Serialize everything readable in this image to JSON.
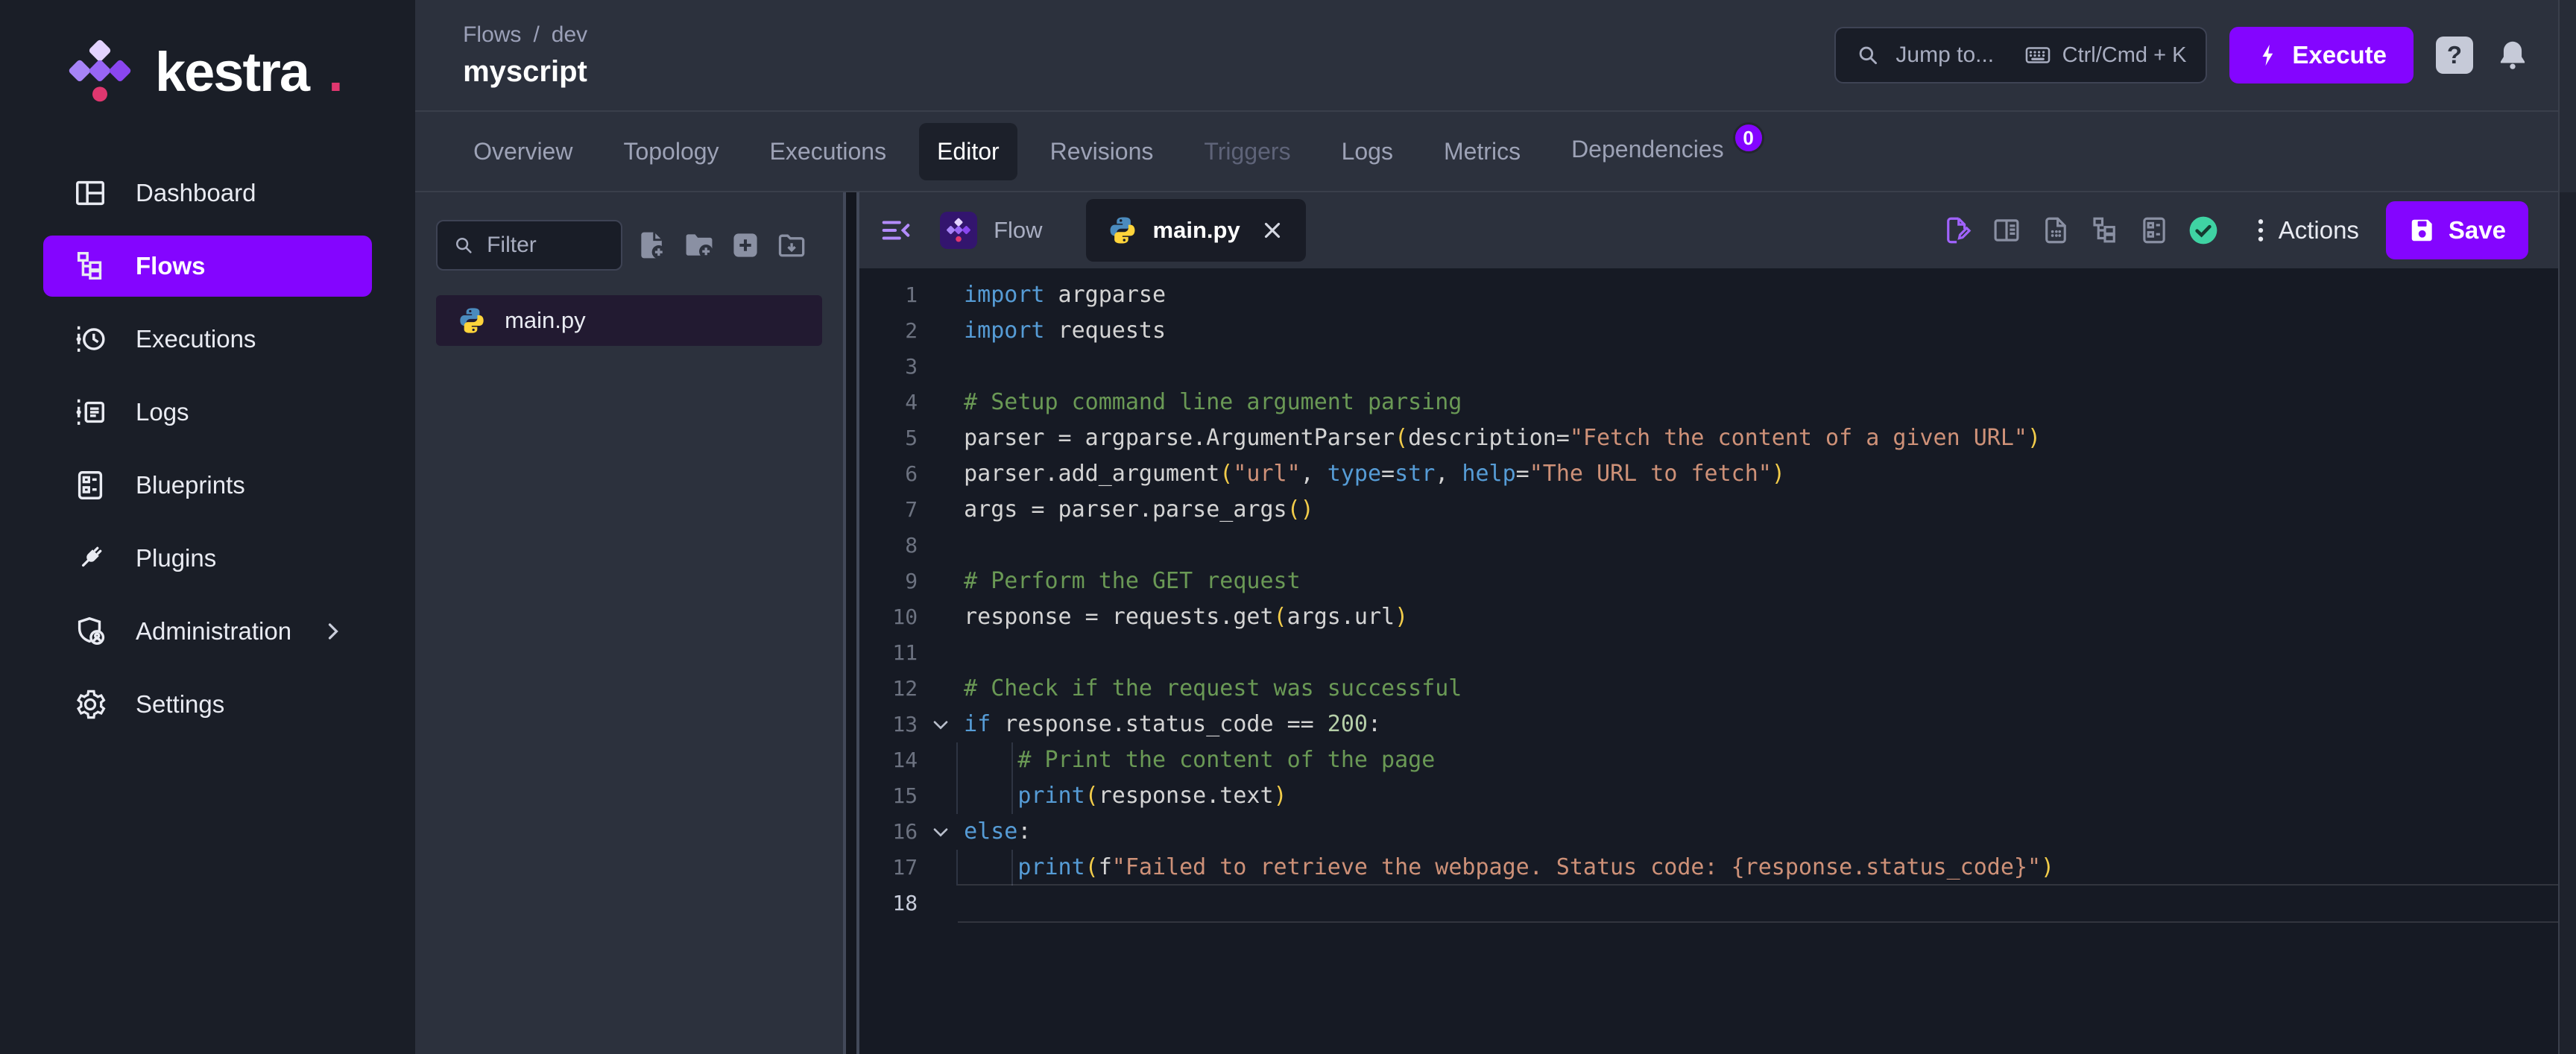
{
  "brand": {
    "name": "kestra",
    "suffix": ".",
    "accent_color": "#8405FF",
    "dot_color": "#E0376F"
  },
  "sidebar": {
    "items": [
      {
        "label": "Dashboard",
        "icon": "dashboard"
      },
      {
        "label": "Flows",
        "icon": "flows",
        "active": true
      },
      {
        "label": "Executions",
        "icon": "executions"
      },
      {
        "label": "Logs",
        "icon": "logs"
      },
      {
        "label": "Blueprints",
        "icon": "blueprints"
      },
      {
        "label": "Plugins",
        "icon": "plugins"
      },
      {
        "label": "Administration",
        "icon": "administration",
        "chevron": true
      },
      {
        "label": "Settings",
        "icon": "settings"
      }
    ]
  },
  "header": {
    "breadcrumb": [
      "Flows",
      "dev"
    ],
    "breadcrumb_separator": "/",
    "title": "myscript",
    "search": {
      "placeholder": "Jump to...",
      "shortcut": "Ctrl/Cmd + K"
    },
    "execute_label": "Execute",
    "help_label": "?"
  },
  "tabs": [
    {
      "label": "Overview"
    },
    {
      "label": "Topology"
    },
    {
      "label": "Executions"
    },
    {
      "label": "Editor",
      "active": true
    },
    {
      "label": "Revisions"
    },
    {
      "label": "Triggers",
      "disabled": true
    },
    {
      "label": "Logs"
    },
    {
      "label": "Metrics"
    },
    {
      "label": "Dependencies",
      "badge": "0"
    }
  ],
  "explorer": {
    "filter_placeholder": "Filter",
    "toolbar_icons": [
      "file-plus",
      "folder-plus",
      "plus-box",
      "folder-down"
    ],
    "files": [
      {
        "name": "main.py",
        "icon": "python",
        "selected": true
      }
    ]
  },
  "editor": {
    "tabs": [
      {
        "label": "Flow",
        "icon": "kestra-mark",
        "boxed": false
      },
      {
        "label": "main.py",
        "icon": "python",
        "boxed": true,
        "active": true,
        "closable": true
      }
    ],
    "toolbar_icons": [
      {
        "icon": "file-edit",
        "name": "edit-script-icon",
        "accent": true
      },
      {
        "icon": "columns",
        "name": "split-view-icon"
      },
      {
        "icon": "file",
        "name": "file-detail-icon"
      },
      {
        "icon": "tree",
        "name": "topology-view-icon"
      },
      {
        "icon": "list-alt",
        "name": "blueprints-view-icon"
      },
      {
        "icon": "check",
        "name": "validation-ok-icon"
      }
    ],
    "actions_label": "Actions",
    "save_label": "Save"
  },
  "code": {
    "language": "python",
    "lines": [
      {
        "n": 1,
        "tokens": [
          [
            "kw",
            "import"
          ],
          [
            "txt",
            " argparse"
          ]
        ]
      },
      {
        "n": 2,
        "tokens": [
          [
            "kw",
            "import"
          ],
          [
            "txt",
            " requests"
          ]
        ]
      },
      {
        "n": 3,
        "tokens": []
      },
      {
        "n": 4,
        "tokens": [
          [
            "com",
            "# Setup command line argument parsing"
          ]
        ]
      },
      {
        "n": 5,
        "tokens": [
          [
            "txt",
            "parser = argparse.ArgumentParser"
          ],
          [
            "br",
            "("
          ],
          [
            "txt",
            "description="
          ],
          [
            "str",
            "\"Fetch the content of a given URL\""
          ],
          [
            "br",
            ")"
          ]
        ]
      },
      {
        "n": 6,
        "tokens": [
          [
            "txt",
            "parser.add_argument"
          ],
          [
            "br",
            "("
          ],
          [
            "str",
            "\"url\""
          ],
          [
            "txt",
            ", "
          ],
          [
            "kw",
            "type"
          ],
          [
            "txt",
            "="
          ],
          [
            "kw",
            "str"
          ],
          [
            "txt",
            ", "
          ],
          [
            "kw",
            "help"
          ],
          [
            "txt",
            "="
          ],
          [
            "str",
            "\"The URL to fetch\""
          ],
          [
            "br",
            ")"
          ]
        ]
      },
      {
        "n": 7,
        "tokens": [
          [
            "txt",
            "args = parser.parse_args"
          ],
          [
            "br",
            "()"
          ]
        ]
      },
      {
        "n": 8,
        "tokens": []
      },
      {
        "n": 9,
        "tokens": [
          [
            "com",
            "# Perform the GET request"
          ]
        ]
      },
      {
        "n": 10,
        "tokens": [
          [
            "txt",
            "response = requests.get"
          ],
          [
            "br",
            "("
          ],
          [
            "txt",
            "args.url"
          ],
          [
            "br",
            ")"
          ]
        ]
      },
      {
        "n": 11,
        "tokens": []
      },
      {
        "n": 12,
        "tokens": [
          [
            "com",
            "# Check if the request was successful"
          ]
        ]
      },
      {
        "n": 13,
        "fold": true,
        "tokens": [
          [
            "kw",
            "if"
          ],
          [
            "txt",
            " response.status_code == "
          ],
          [
            "num",
            "200"
          ],
          [
            "txt",
            ":"
          ]
        ]
      },
      {
        "n": 14,
        "guides": true,
        "tokens": [
          [
            "txt",
            "    "
          ],
          [
            "com",
            "# Print the content of the page"
          ]
        ]
      },
      {
        "n": 15,
        "guides": true,
        "tokens": [
          [
            "txt",
            "    "
          ],
          [
            "kw",
            "print"
          ],
          [
            "br",
            "("
          ],
          [
            "txt",
            "response.text"
          ],
          [
            "br",
            ")"
          ]
        ]
      },
      {
        "n": 16,
        "fold": true,
        "tokens": [
          [
            "kw",
            "else"
          ],
          [
            "txt",
            ":"
          ]
        ]
      },
      {
        "n": 17,
        "guides": true,
        "tokens": [
          [
            "txt",
            "    "
          ],
          [
            "kw",
            "print"
          ],
          [
            "br",
            "("
          ],
          [
            "txt",
            "f"
          ],
          [
            "str",
            "\"Failed to retrieve the webpage. Status code: {response.status_code}\""
          ],
          [
            "br",
            ")"
          ]
        ]
      },
      {
        "n": 18,
        "current": true,
        "tokens": []
      }
    ]
  }
}
